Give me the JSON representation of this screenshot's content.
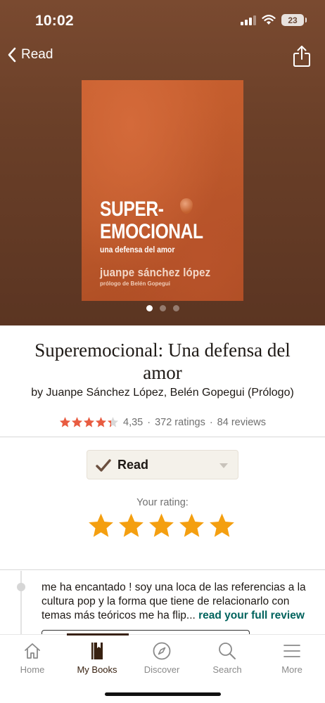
{
  "status_bar": {
    "time": "10:02",
    "battery_level": "23"
  },
  "nav": {
    "back_label": "Read"
  },
  "cover": {
    "title": "SUPER-\nEMOCIONAL",
    "subtitle": "una defensa del amor",
    "author": "juanpe sánchez lópez",
    "prologue": "prólogo de Belén Gopegui",
    "page_count": 3,
    "active_page": 0
  },
  "book": {
    "title": "Superemocional: Una defensa del amor",
    "authors": "by Juanpe Sánchez López, Belén Gopegui (Prólogo)",
    "average_rating": "4,35",
    "average_rating_value": 4.35,
    "ratings_count": "372 ratings",
    "reviews_count": "84 reviews",
    "rating_separator": "·"
  },
  "shelf": {
    "label": "Read"
  },
  "your_rating": {
    "label": "Your rating:",
    "stars": 5,
    "max_stars": 5
  },
  "review": {
    "text": "me ha encantado ! soy una loca de las referencias a la cultura pop y la forma que tiene de relacionarlo con temas más teóricos me ha flip...",
    "link_label": "read your full review"
  },
  "tabs": [
    {
      "label": "Home",
      "icon": "home-icon",
      "active": false
    },
    {
      "label": "My Books",
      "icon": "book-icon",
      "active": true
    },
    {
      "label": "Discover",
      "icon": "compass-icon",
      "active": false
    },
    {
      "label": "Search",
      "icon": "search-icon",
      "active": false
    },
    {
      "label": "More",
      "icon": "menu-icon",
      "active": false
    }
  ],
  "colors": {
    "hero_brown": "#6a3f28",
    "rating_red": "#e85c41",
    "your_star_orange": "#f49f10",
    "link_green": "#00635d",
    "tab_active": "#382110"
  }
}
